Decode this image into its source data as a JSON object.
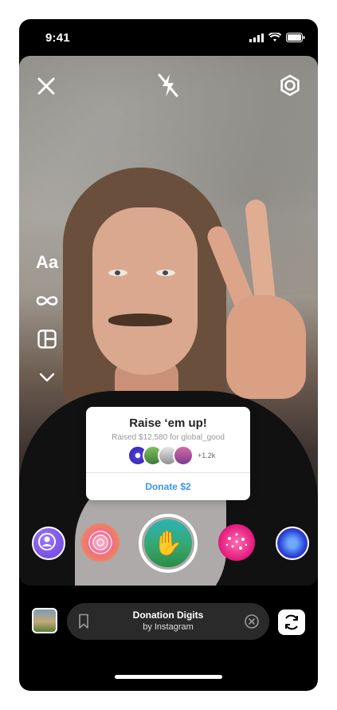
{
  "status_bar": {
    "time": "9:41"
  },
  "sticker": {
    "title": "Raise ‘em up!",
    "subtitle": "Raised $12,580 for global_good",
    "supporter_count": "+1.2k",
    "donate_label": "Donate $2",
    "donate_color": "#3897f0"
  },
  "left_tools": {
    "text_tool": "Aa"
  },
  "effect_bar": {
    "title": "Donation Digits",
    "subtitle": "by Instagram"
  },
  "icons": [
    "close-icon",
    "flash-off-icon",
    "settings-icon",
    "boomerang-icon",
    "layout-icon",
    "chevron-down-icon",
    "bookmark-icon",
    "close-circle-icon",
    "camera-flip-icon",
    "raised-hand-icon"
  ]
}
